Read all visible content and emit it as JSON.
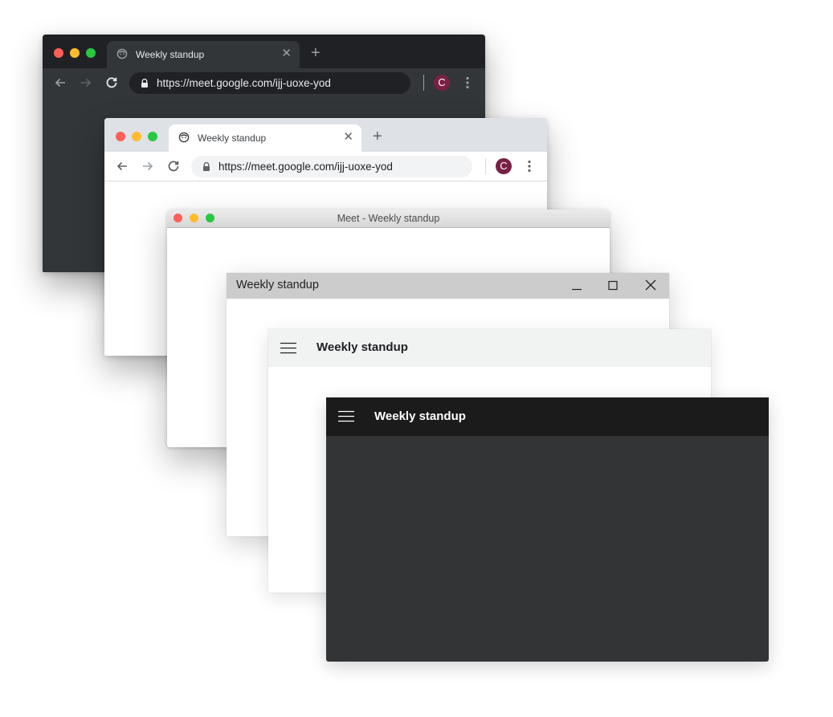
{
  "meeting_title": "Weekly standup",
  "chrome_dark": {
    "tab_title": "Weekly standup",
    "url": "https://meet.google.com/ijj-uoxe-yod",
    "avatar_letter": "C"
  },
  "chrome_light": {
    "tab_title": "Weekly standup",
    "url": "https://meet.google.com/ijj-uoxe-yod",
    "avatar_letter": "C"
  },
  "mac_window": {
    "title": "Meet - Weekly standup"
  },
  "windows_window": {
    "title": "Weekly standup"
  },
  "app_light": {
    "title": "Weekly standup"
  },
  "app_dark": {
    "title": "Weekly standup"
  },
  "colors": {
    "traffic_red": "#ff5f57",
    "traffic_yellow": "#febc2e",
    "traffic_green": "#28c840",
    "avatar_bg": "#7a1f45",
    "dark_surface": "#323639",
    "dark_tabstrip": "#202124"
  },
  "icons": {
    "favicon": "meet-face-icon",
    "back": "arrow-left-icon",
    "forward": "arrow-right-icon",
    "reload": "reload-icon",
    "lock": "lock-icon",
    "menu": "kebab-menu-icon",
    "hamburger": "hamburger-menu-icon",
    "minimize": "minimize-icon",
    "maximize": "maximize-icon",
    "close": "close-icon"
  }
}
